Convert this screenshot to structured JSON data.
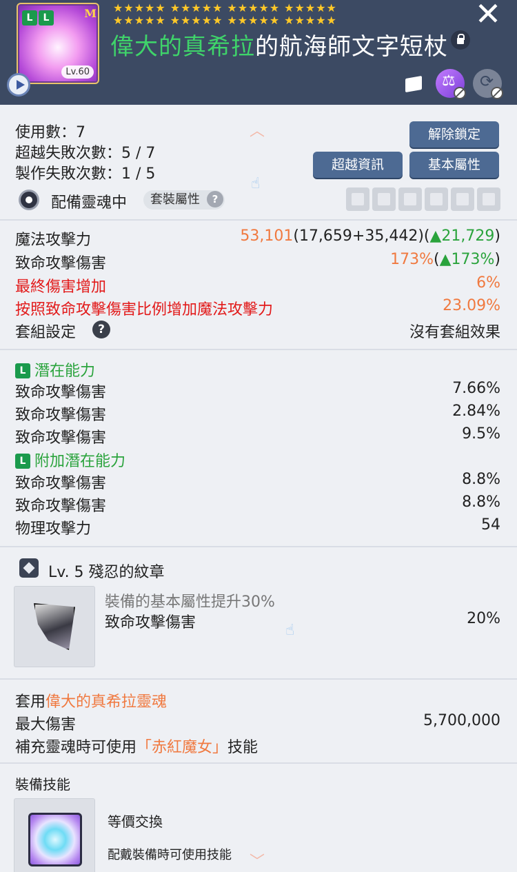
{
  "header": {
    "badges": [
      "L",
      "L"
    ],
    "grade_mark": "M",
    "level": "Lv.60",
    "stars": [
      "★★★★★",
      "★★★★★",
      "★★★★★",
      "★★★★★",
      "★★★★★",
      "★★★★★",
      "★★★★★",
      "★★★★★"
    ],
    "title_highlight": "偉大的真希拉",
    "title_rest": "的航海師文字短杖",
    "close_glyph": "✕"
  },
  "info": {
    "use_count": "使用數：7",
    "transcend_fail": "超越失敗次數：5 / 7",
    "craft_fail": "製作失敗次數：1 / 5",
    "unlock_button": "解除鎖定",
    "transcend_button": "超越資訊",
    "basic_button": "基本屬性",
    "soul_label": "配備靈魂中",
    "set_pill": "套裝屬性",
    "question": "?"
  },
  "stats": {
    "magic_atk_label": "魔法攻擊力",
    "magic_atk_value": "53,101",
    "magic_atk_breakdown": "(17,659+35,442)(",
    "magic_atk_delta": "▲21,729",
    "magic_atk_close": ")",
    "crit_label": "致命攻擊傷害",
    "crit_value": "173%",
    "crit_open": "(",
    "crit_delta": "▲173%",
    "crit_close": ")",
    "final_dmg_label": "最終傷害增加",
    "final_dmg_value": "6%",
    "crit_ratio_label": "按照致命攻擊傷害比例增加魔法攻擊力",
    "crit_ratio_value": "23.09%",
    "set_label": "套組設定",
    "set_value": "沒有套組效果"
  },
  "potential": {
    "badge": "L",
    "title": "潛在能力",
    "lines": [
      {
        "label": "致命攻擊傷害",
        "value": "7.66%"
      },
      {
        "label": "致命攻擊傷害",
        "value": "2.84%"
      },
      {
        "label": "致命攻擊傷害",
        "value": "9.5%"
      }
    ],
    "extra_title": "附加潛在能力",
    "extra_lines": [
      {
        "label": "致命攻擊傷害",
        "value": "8.8%"
      },
      {
        "label": "致命攻擊傷害",
        "value": "8.8%"
      },
      {
        "label": "物理攻擊力",
        "value": "54"
      }
    ]
  },
  "emblem": {
    "title": "Lv. 5 殘忍的紋章",
    "desc": "裝備的基本屬性提升30%",
    "stat_label": "致命攻擊傷害",
    "stat_value": "20%"
  },
  "soul": {
    "prefix": "套用",
    "name": "偉大的真希拉靈魂",
    "max_dmg_label": "最大傷害",
    "max_dmg_value": "5,700,000",
    "skill_prefix": "補充靈魂時可使用",
    "skill_name": "「赤紅魔女」",
    "skill_suffix": "技能"
  },
  "equip_skill": {
    "title": "裝備技能",
    "name": "等價交換",
    "desc": "配戴裝備時可使用技能"
  }
}
